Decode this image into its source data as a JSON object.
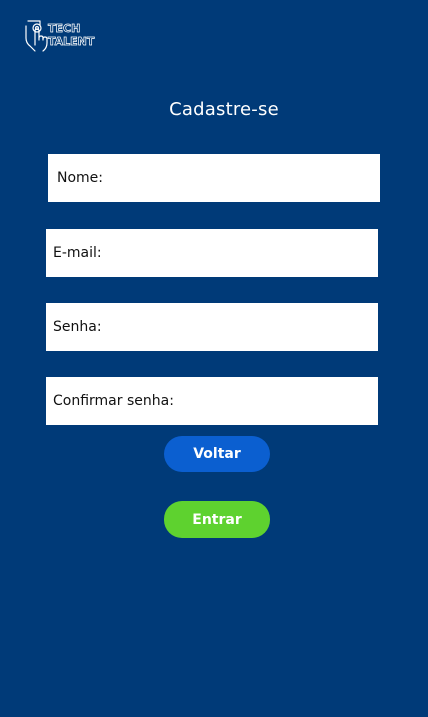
{
  "logo": {
    "line1": "TECH",
    "line2": "TALENT",
    "icon": "hand-touch-icon"
  },
  "page": {
    "title": "Cadastre-se"
  },
  "form": {
    "name_label": "Nome:",
    "email_label": "E-mail:",
    "password_label": "Senha:",
    "confirm_label": "Confirmar senha:"
  },
  "buttons": {
    "back_label": "Voltar",
    "enter_label": "Entrar"
  },
  "colors": {
    "background": "#003a78",
    "back_button": "#0b5fd0",
    "enter_button": "#5ed22f",
    "field": "#ffffff"
  }
}
